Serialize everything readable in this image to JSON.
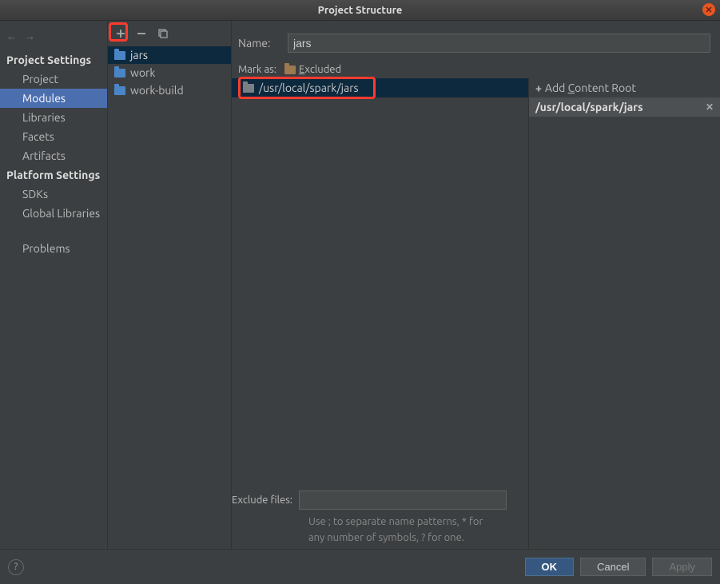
{
  "window": {
    "title": "Project Structure"
  },
  "sidebar": {
    "sections": [
      {
        "title": "Project Settings",
        "items": [
          {
            "label": "Project",
            "selected": false
          },
          {
            "label": "Modules",
            "selected": true
          },
          {
            "label": "Libraries",
            "selected": false
          },
          {
            "label": "Facets",
            "selected": false
          },
          {
            "label": "Artifacts",
            "selected": false
          }
        ]
      },
      {
        "title": "Platform Settings",
        "items": [
          {
            "label": "SDKs",
            "selected": false
          },
          {
            "label": "Global Libraries",
            "selected": false
          }
        ]
      }
    ],
    "extra": {
      "label": "Problems"
    }
  },
  "modules": {
    "items": [
      {
        "label": "jars",
        "selected": true
      },
      {
        "label": "work",
        "selected": false
      },
      {
        "label": "work-build",
        "selected": false
      }
    ]
  },
  "detail": {
    "name_label": "Name:",
    "name_value": "jars",
    "markas_label": "Mark as:",
    "excluded_label": "Excluded",
    "tree_path": "/usr/local/spark/jars",
    "exclude_label": "Exclude files:",
    "exclude_value": "",
    "hint_line1": "Use ; to separate name patterns, * for",
    "hint_line2": "any number of symbols, ? for one."
  },
  "roots": {
    "add_label": "Add Content Root",
    "items": [
      {
        "path": "/usr/local/spark/jars"
      }
    ]
  },
  "footer": {
    "ok": "OK",
    "cancel": "Cancel",
    "apply": "Apply"
  }
}
